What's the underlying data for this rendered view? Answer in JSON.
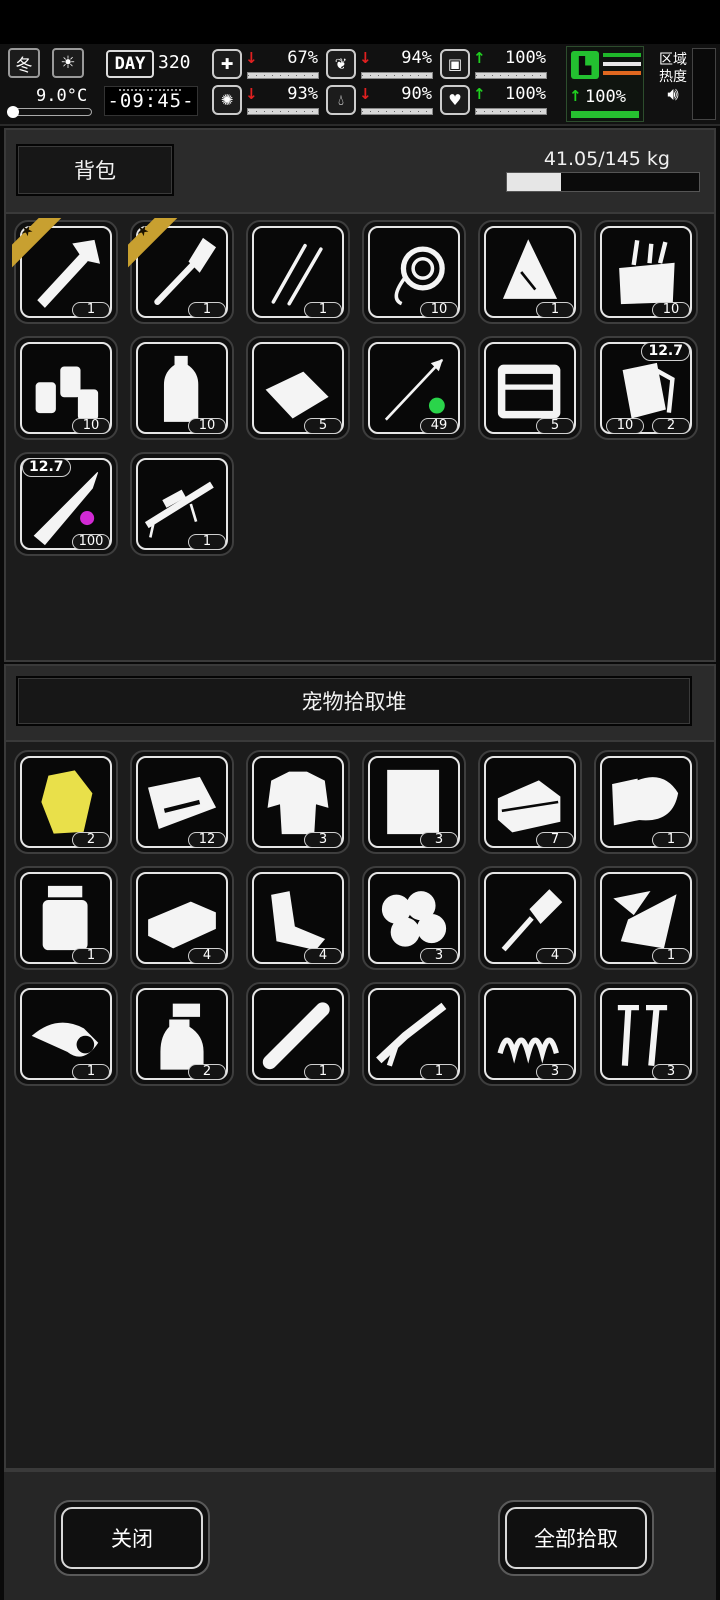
{
  "hud": {
    "season": "冬",
    "weather_icon": "sun-icon",
    "temperature": "9.0°C",
    "day_label": "DAY",
    "day_number": "320",
    "clock": "-09:45-",
    "stats": [
      {
        "name": "health",
        "icon": "medkit-icon",
        "trend": "down",
        "value": "67%"
      },
      {
        "name": "hunger",
        "icon": "stomach-icon",
        "trend": "down",
        "value": "94%"
      },
      {
        "name": "armor",
        "icon": "capsule-icon",
        "trend": "up",
        "value": "100%"
      },
      {
        "name": "sanity",
        "icon": "brain-icon",
        "trend": "down",
        "value": "93%"
      },
      {
        "name": "thirst",
        "icon": "water-drop-icon",
        "trend": "down",
        "value": "90%"
      },
      {
        "name": "mood",
        "icon": "heart-icon",
        "trend": "up",
        "value": "100%"
      }
    ],
    "stamina": {
      "icon": "boot-icon",
      "trend": "up",
      "value": "100%",
      "stripe_colors": [
        "#1fb82a",
        "#e8e8e8",
        "#e06820"
      ]
    },
    "zone_label_1": "区域",
    "zone_label_2": "热度",
    "zone_sound_icon": "speaker-icon"
  },
  "backpack": {
    "title": "背包",
    "weight": "41.05/145 kg",
    "weight_fraction": 0.283,
    "items": [
      {
        "icon": "hatchet-icon",
        "count": "1",
        "favorite": true
      },
      {
        "icon": "shovel-icon",
        "count": "1",
        "favorite": true
      },
      {
        "icon": "lockpick-icon",
        "count": "1"
      },
      {
        "icon": "rope-icon",
        "count": "10"
      },
      {
        "icon": "tarp-icon",
        "count": "1"
      },
      {
        "icon": "toolbag-icon",
        "count": "10"
      },
      {
        "icon": "fuel-cans-icon",
        "count": "10"
      },
      {
        "icon": "water-bottle-icon",
        "count": "10"
      },
      {
        "icon": "bread-icon",
        "count": "5"
      },
      {
        "icon": "poison-arrow-icon",
        "count": "49"
      },
      {
        "icon": "toolbox-icon",
        "count": "5"
      },
      {
        "icon": "ammo-pouch-icon",
        "count": "10",
        "count2": "2",
        "caliber": "12.7"
      },
      {
        "icon": "rifle-bullet-icon",
        "count": "100",
        "caliber": "12.7"
      },
      {
        "icon": "sniper-rifle-icon",
        "count": "1"
      }
    ]
  },
  "pet_pile": {
    "title": "宠物拾取堆",
    "items": [
      {
        "icon": "gold-ore-icon",
        "count": "2"
      },
      {
        "icon": "meat-icon",
        "count": "12"
      },
      {
        "icon": "torn-shirt-icon",
        "count": "3"
      },
      {
        "icon": "cloth-sheet-icon",
        "count": "3"
      },
      {
        "icon": "folded-cloth-icon",
        "count": "7"
      },
      {
        "icon": "bandage-roll-icon",
        "count": "1"
      },
      {
        "icon": "jar-icon",
        "count": "1"
      },
      {
        "icon": "brick-icon",
        "count": "4"
      },
      {
        "icon": "rags-icon",
        "count": "4"
      },
      {
        "icon": "cotton-balls-icon",
        "count": "3"
      },
      {
        "icon": "air-filter-icon",
        "count": "4"
      },
      {
        "icon": "glass-shards-icon",
        "count": "1"
      },
      {
        "icon": "tape-roll-icon",
        "count": "1"
      },
      {
        "icon": "spray-bottle-icon",
        "count": "2"
      },
      {
        "icon": "pipe-icon",
        "count": "1"
      },
      {
        "icon": "rifle-parts-icon",
        "count": "1"
      },
      {
        "icon": "spring-icon",
        "count": "3"
      },
      {
        "icon": "screws-icon",
        "count": "3"
      }
    ]
  },
  "buttons": {
    "close": "关闭",
    "take_all": "全部拾取"
  }
}
